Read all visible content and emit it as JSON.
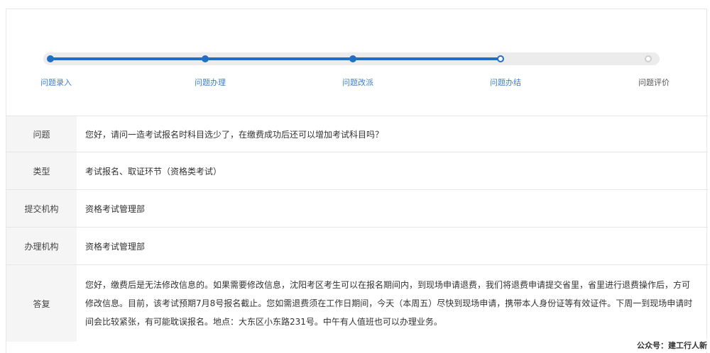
{
  "steps": [
    {
      "label": "问题录入",
      "state": "done"
    },
    {
      "label": "问题办理",
      "state": "done"
    },
    {
      "label": "问题改派",
      "state": "done"
    },
    {
      "label": "问题办结",
      "state": "current"
    },
    {
      "label": "问题评价",
      "state": "todo"
    }
  ],
  "details": [
    {
      "key": "问题",
      "value": "您好，请问一造考试报名时科目选少了，在缴费成功后还可以增加考试科目吗？"
    },
    {
      "key": "类型",
      "value": "考试报名、取证环节（资格类考试）"
    },
    {
      "key": "提交机构",
      "value": "资格考试管理部"
    },
    {
      "key": "办理机构",
      "value": "资格考试管理部"
    },
    {
      "key": "答复",
      "value": "您好，缴费后是无法修改信息的。如果需要修改信息，沈阳考区考生可以在报名期间内，到现场申请退费，我们将退费申请提交省里，省里进行退费操作后，方可修改信息。目前，该考试预期7月8号报名截止。您如需退费须在工作日期间，今天（本周五）尽快到现场申请，携带本人身份证等有效证件。下周一到现场申请时间会比较紧张，有可能耽误报名。地点：大东区小东路231号。中午有人值班也可以办理业务。"
    }
  ],
  "watermark": "公众号：建工行人新",
  "colors": {
    "accent": "#1e6fc5",
    "track": "#ececec",
    "label_bg": "#f5f5f5"
  }
}
